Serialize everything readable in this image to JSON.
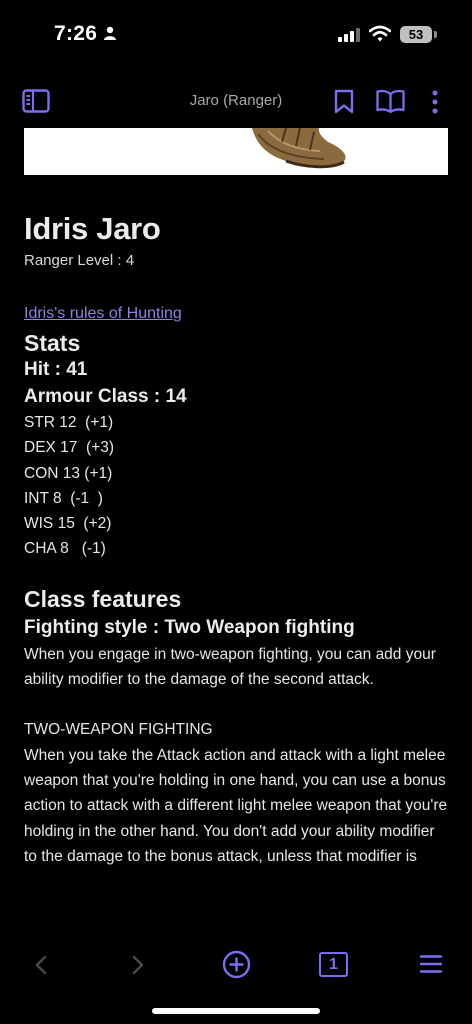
{
  "status_bar": {
    "time": "7:26",
    "battery": "53"
  },
  "header": {
    "title": "Jaro (Ranger)"
  },
  "character": {
    "name": "Idris Jaro",
    "level_line": "Ranger Level : 4",
    "rules_link": "Idris's rules of Hunting"
  },
  "stats": {
    "heading": "Stats",
    "hit": "Hit :  41",
    "armour": "Armour Class : 14",
    "abilities": [
      "STR 12  (+1)",
      "DEX 17  (+3)",
      "CON 13 (+1)",
      "INT 8  (-1  )",
      "WIS 15  (+2)",
      "CHA 8   (-1)"
    ]
  },
  "features": {
    "heading": "Class features",
    "fighting_style": "Fighting style : Two Weapon fighting",
    "description": "When you engage in two-weapon fighting, you can add your ability modifier to the damage of the second attack.",
    "twf_title": "TWO-WEAPON FIGHTING",
    "twf_text": "When you take the Attack action and attack with a light melee weapon that you're holding in one hand, you can use a bonus action to attack with a different light melee weapon that you're holding in the other hand. You don't add your ability modifier to the damage to the bonus attack, unless that modifier is"
  },
  "toolbar": {
    "tab_count": "1"
  },
  "colors": {
    "accent": "#7b6ef0",
    "background": "#000000",
    "link": "#8e82e8"
  },
  "icons": [
    "person-icon",
    "signal-icon",
    "wifi-icon",
    "battery-icon",
    "sidebar-icon",
    "bookmark-icon",
    "book-icon",
    "more-vertical-icon",
    "back-arrow-icon",
    "forward-arrow-icon",
    "add-circle-icon",
    "tabs-icon",
    "menu-icon"
  ]
}
